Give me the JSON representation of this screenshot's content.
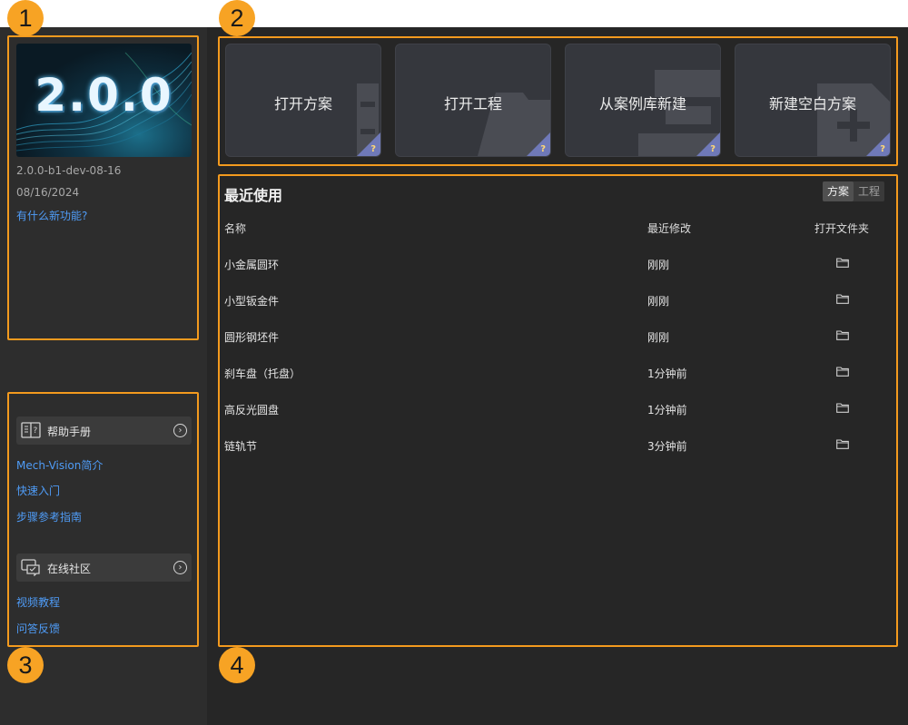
{
  "sidebar": {
    "version": "2.0.0-b1-dev-08-16",
    "date": "08/16/2024",
    "banner_text": "2.0.0",
    "whats_new": "有什么新功能?",
    "help_manual": "帮助手册",
    "help_links": [
      "Mech-Vision简介",
      "快速入门",
      "步骤参考指南"
    ],
    "community": "在线社区",
    "community_links": [
      "视频教程",
      "问答反馈"
    ]
  },
  "quick_actions": [
    {
      "label": "打开方案"
    },
    {
      "label": "打开工程"
    },
    {
      "label": "从案例库新建"
    },
    {
      "label": "新建空白方案"
    }
  ],
  "recent": {
    "title": "最近使用",
    "tabs": [
      "方案",
      "工程"
    ],
    "active_tab": "方案",
    "columns": [
      "名称",
      "最近修改",
      "打开文件夹"
    ],
    "rows": [
      {
        "name": "小金属圆环",
        "modified": "刚刚"
      },
      {
        "name": "小型钣金件",
        "modified": "刚刚"
      },
      {
        "name": "圆形钢坯件",
        "modified": "刚刚"
      },
      {
        "name": "刹车盘（托盘）",
        "modified": "1分钟前"
      },
      {
        "name": "高反光圆盘",
        "modified": "1分钟前"
      },
      {
        "name": "链轨节",
        "modified": "3分钟前"
      }
    ]
  },
  "callouts": [
    "1",
    "2",
    "3",
    "4"
  ],
  "colors": {
    "highlight": "#f39a1e",
    "badge": "#f7a324",
    "link": "#4f9cf7"
  }
}
